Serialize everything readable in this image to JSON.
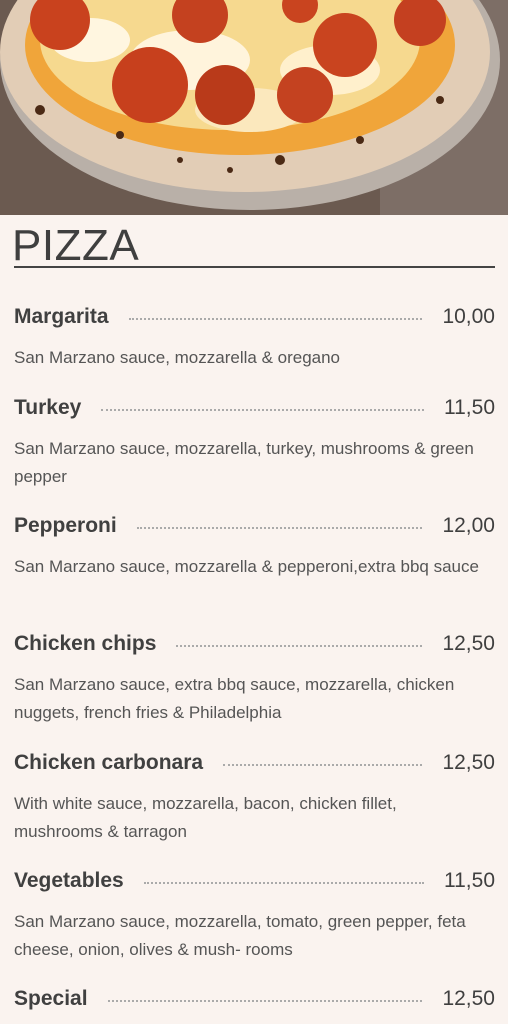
{
  "section": {
    "title": "PIZZA"
  },
  "items": [
    {
      "name": "Margarita",
      "price": "10,00",
      "description": "San Marzano sauce, mozzarella & oregano"
    },
    {
      "name": "Turkey",
      "price": "11,50",
      "description": "San Marzano sauce, mozzarella, turkey, mushrooms & green pepper"
    },
    {
      "name": "Pepperoni",
      "price": "12,00",
      "description": "San Marzano sauce, mozzarella & pepperoni,extra bbq sauce"
    },
    {
      "name": "Chicken chips",
      "price": "12,50",
      "description": "San Marzano sauce, extra bbq sauce, mozzarella, chicken nuggets, french fries & Philadelphia"
    },
    {
      "name": "Chicken carbonara",
      "price": "12,50",
      "description": "With white sauce, mozzarella, bacon, chicken fillet, mushrooms & tarragon"
    },
    {
      "name": "Vegetables",
      "price": "11,50",
      "description": "San Marzano sauce, mozzarella, tomato, green pepper, feta cheese, onion, olives & mush- rooms"
    },
    {
      "name": "Special",
      "price": "12,50",
      "description": ""
    }
  ]
}
